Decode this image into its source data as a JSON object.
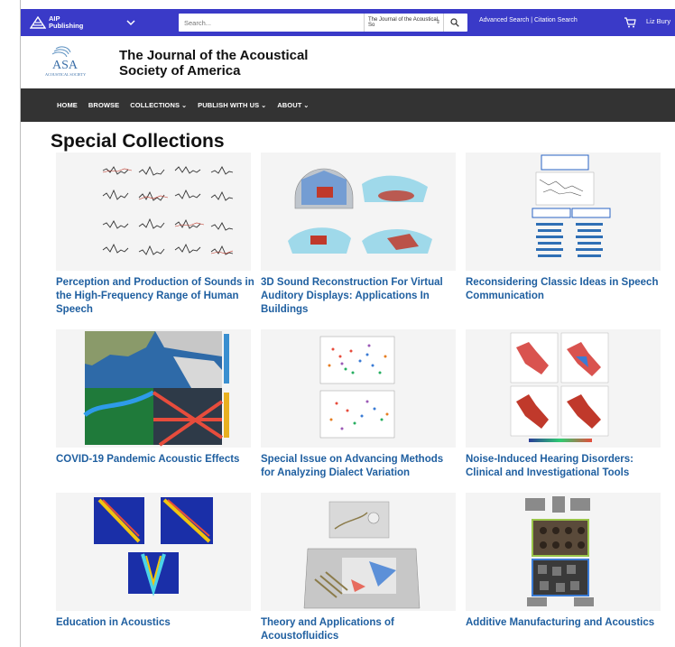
{
  "topbar": {
    "brand_line1": "AIP",
    "brand_line2": "Publishing",
    "search_placeholder": "Search...",
    "search_scope": "The Journal of the Acoustical So",
    "adv_search": "Advanced Search | Citation Search",
    "user": "Liz Bury"
  },
  "journal": {
    "title_line1": "The Journal of the Acoustical",
    "title_line2": "Society of America",
    "logo_text": "ASA",
    "logo_sub": "ACOUSTICAL SOCIETY"
  },
  "nav": {
    "home": "HOME",
    "browse": "BROWSE",
    "collections": "COLLECTIONS",
    "publish": "PUBLISH WITH US",
    "about": "ABOUT"
  },
  "main": {
    "title": "Special Collections",
    "cards": [
      {
        "title": "Perception and Production of Sounds in the High-Frequency Range of Human Speech"
      },
      {
        "title": "3D Sound Reconstruction For Virtual Auditory Displays: Applications In Buildings"
      },
      {
        "title": "Reconsidering Classic Ideas in Speech Communication"
      },
      {
        "title": "COVID-19 Pandemic Acoustic Effects"
      },
      {
        "title": "Special Issue on Advancing Methods for Analyzing Dialect Variation"
      },
      {
        "title": "Noise-Induced Hearing Disorders: Clinical and Investigational Tools"
      },
      {
        "title": "Education in Acoustics"
      },
      {
        "title": "Theory and Applications of Acoustofluidics"
      },
      {
        "title": "Additive Manufacturing and Acoustics"
      }
    ]
  },
  "colors": {
    "topbar": "#3a3ac8",
    "nav": "#333333",
    "link": "#1f5fa0"
  }
}
